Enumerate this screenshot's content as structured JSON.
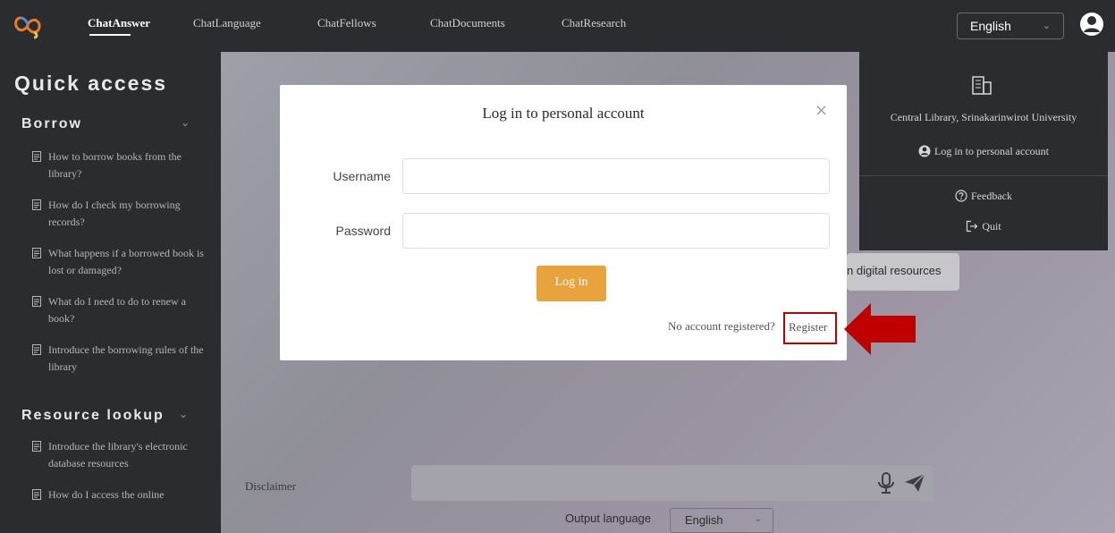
{
  "nav": {
    "items": [
      "ChatAnswer",
      "ChatLanguage",
      "ChatFellows",
      "ChatDocuments",
      "ChatResearch"
    ],
    "active": "ChatAnswer",
    "language": "English"
  },
  "sidebar": {
    "title": "Quick access",
    "sections": [
      {
        "title": "Borrow",
        "items": [
          "How to borrow books from the library?",
          "How do I check my borrowing records?",
          "What happens if a borrowed book is lost or damaged?",
          "What do I need to do to renew a book?",
          "Introduce the borrowing rules of the library"
        ]
      },
      {
        "title": "Resource lookup",
        "items": [
          "Introduce the library's electronic database resources",
          "How do I access the online"
        ]
      }
    ]
  },
  "main": {
    "bg_pill_text": "n digital resources",
    "disclaimer": "Disclaimer",
    "output_language_label": "Output language",
    "output_language_value": "English"
  },
  "modal": {
    "title": "Log in to personal account",
    "close": "×",
    "username_label": "Username",
    "password_label": "Password",
    "login_button": "Log in",
    "no_account_text": "No account registered?",
    "register_link": "Register"
  },
  "dropdown": {
    "library": "Central Library, Srinakarinwirot University",
    "login": "Log in to personal account",
    "feedback": "Feedback",
    "quit": "Quit"
  },
  "colors": {
    "dark": "#2b2c2f",
    "accent": "#e9a33c",
    "highlight": "#c00000"
  }
}
